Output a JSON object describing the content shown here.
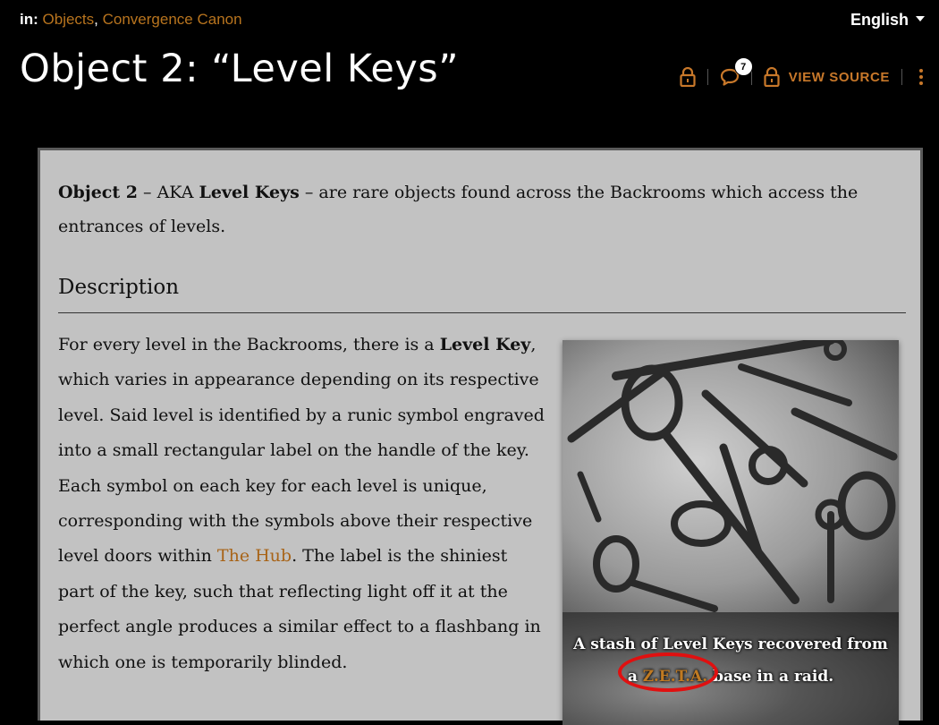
{
  "breadcrumb": {
    "prefix": "in:",
    "links": [
      "Objects",
      "Convergence Canon"
    ],
    "separator": ","
  },
  "language": {
    "label": "English"
  },
  "page_title": "Object 2: “Level Keys”",
  "toolbar": {
    "comment_count": "7",
    "view_source_label": "VIEW SOURCE"
  },
  "article": {
    "intro": {
      "bold1": "Object 2",
      "t1": " – AKA ",
      "bold2": "Level Keys",
      "t2": " – are rare objects found across the Backrooms which access the entrances of levels."
    },
    "description_heading": "Description",
    "body": {
      "t1": "For every level in the Backrooms, there is a ",
      "bold1": "Level Key",
      "t2": ", which varies in appearance depending on its respective level. Said level is identified by a runic symbol engraved into a small rectangular label on the handle of the key. Each symbol on each key for each level is unique, corresponding with the symbols above their respective level doors within ",
      "link": "The Hub",
      "t3": ". The label is the shiniest part of the key, such that reflecting light off it at the perfect angle produces a similar effect to a flashbang in which one is temporarily blinded."
    },
    "figure": {
      "caption_line1": "A stash of Level Keys recovered from",
      "caption_pre": "a ",
      "caption_link": "Z.E.T.A.",
      "caption_post": " base in a raid."
    }
  },
  "colors": {
    "accent": "#c8782a",
    "link": "#b8741e",
    "content_bg": "#c2c2c2",
    "annotation": "#e01010"
  },
  "icons": [
    "lock-icon",
    "comment-icon",
    "lock-icon",
    "more-vertical-icon",
    "chevron-down-icon"
  ]
}
